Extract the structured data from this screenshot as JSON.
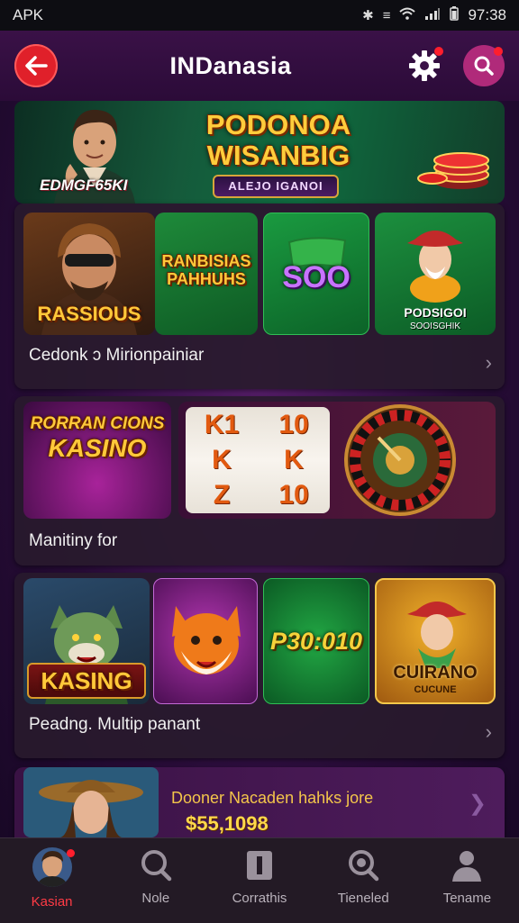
{
  "status_bar": {
    "left": "APK",
    "time": "97:38"
  },
  "header": {
    "title": "INDanasia"
  },
  "banner": {
    "headline_line1": "PODONOA",
    "headline_line2": "WISANBIG",
    "sub_label": "ALEJO IGANOI",
    "person_tag": "EDMGF65KI"
  },
  "section1": {
    "label": "Cedonk ɔ Mirionpainiar",
    "tiles": [
      {
        "text": "RASSIOUS"
      },
      {
        "text_line1": "RANBISIAS",
        "text_line2": "PAHHUHS"
      },
      {
        "text": "SOO"
      },
      {
        "text_line1": "PODSIGOI",
        "text_line2": "SOOISGHIK"
      }
    ]
  },
  "section2": {
    "label": "Manitiny for",
    "tiles": [
      {
        "text_line1": "RORRAN CIONS",
        "text_line2": "KASINO"
      },
      {
        "slot_symbols": [
          "K1",
          "10",
          "K",
          "K",
          "Z",
          "10"
        ]
      }
    ]
  },
  "section3": {
    "label": "Peadng. Multip panant",
    "tiles": [
      {
        "text": "KASING"
      },
      {
        "text": ""
      },
      {
        "text": "P30:010"
      },
      {
        "text_line1": "CUIRANO",
        "text_line2": "CUCUNE"
      }
    ]
  },
  "promo": {
    "title": "Dooner Nacaden hahks jore",
    "amount": "$55,1098"
  },
  "bottom_nav": [
    {
      "label": "Kasian",
      "icon": "avatar",
      "active": true
    },
    {
      "label": "Nole",
      "icon": "search-outline-icon",
      "active": false
    },
    {
      "label": "Corrathis",
      "icon": "card-icon",
      "active": false
    },
    {
      "label": "Tieneled",
      "icon": "magnifier-icon",
      "active": false
    },
    {
      "label": "Tename",
      "icon": "person-icon",
      "active": false
    }
  ],
  "colors": {
    "accent": "#e0202a",
    "search_btn": "#b02a7a",
    "gold": "#ffc93a"
  }
}
